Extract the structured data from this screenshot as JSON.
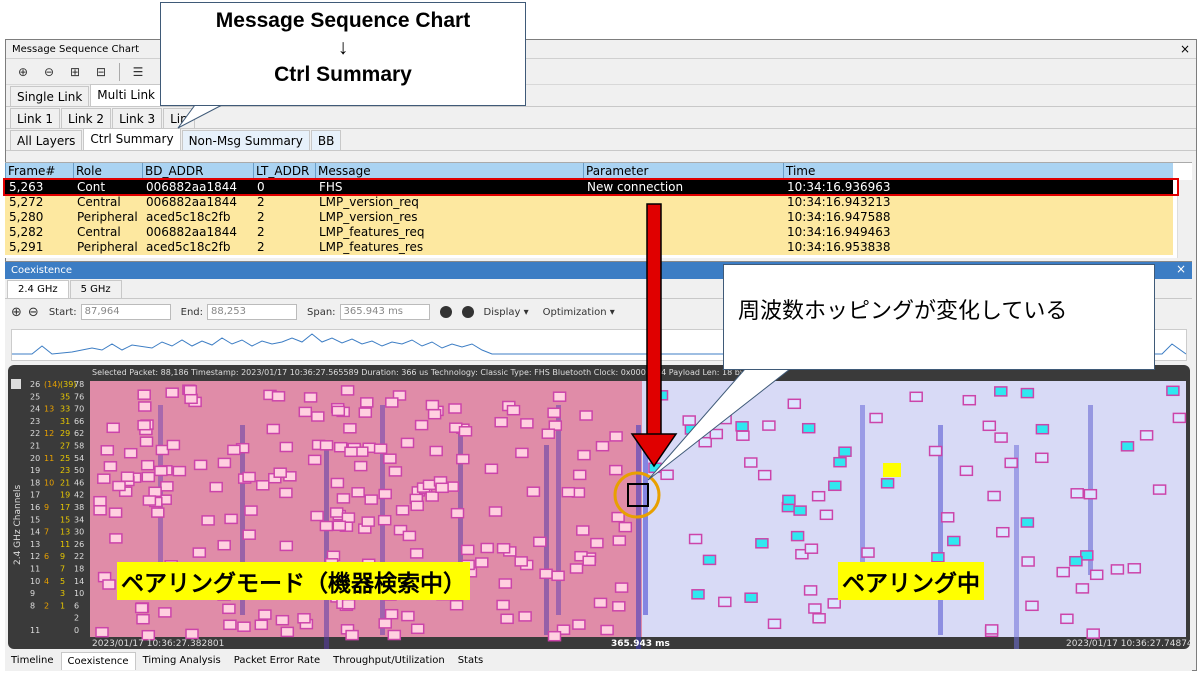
{
  "msc": {
    "title": "Message Sequence Chart",
    "close": "×",
    "link_tabs": [
      "Single Link",
      "Multi Link"
    ],
    "sub_tabs": [
      "Link 1",
      "Link 2",
      "Link 3",
      "Lin"
    ],
    "layer_tabs": [
      "All Layers",
      "Ctrl Summary",
      "Non-Msg Summary",
      "BB"
    ],
    "columns": [
      "Frame#",
      "Role",
      "BD_ADDR",
      "LT_ADDR",
      "Message",
      "Parameter",
      "Time"
    ],
    "rows": [
      [
        "5,263",
        "Cont",
        "006882aa1844",
        "0",
        "FHS",
        "New connection",
        "10:34:16.936963"
      ],
      [
        "5,272",
        "Central",
        "006882aa1844",
        "2",
        "LMP_version_req",
        "",
        "10:34:16.943213"
      ],
      [
        "5,280",
        "Peripheral",
        "aced5c18c2fb",
        "2",
        "LMP_version_res",
        "",
        "10:34:16.947588"
      ],
      [
        "5,282",
        "Central",
        "006882aa1844",
        "2",
        "LMP_features_req",
        "",
        "10:34:16.949463"
      ],
      [
        "5,291",
        "Peripheral",
        "aced5c18c2fb",
        "2",
        "LMP_features_res",
        "",
        "10:34:16.953838"
      ]
    ]
  },
  "coex": {
    "title": "Coexistence",
    "close": "×",
    "freq_tabs": [
      "2.4 GHz",
      "5 GHz"
    ],
    "start_label": "Start:",
    "start_value": "87,964",
    "end_label": "End:",
    "end_value": "88,253",
    "span_label": "Span:",
    "span_value": "365.943 ms",
    "display_menu": "Display",
    "optimization_menu": "Optimization",
    "info": "Selected Packet: 88,186    Timestamp: 2023/01/17 10:36:27.565589    Duration: 366 us    Technology: Classic    Type: FHS    Bluetooth Clock: 0x0007134    Payload Len: 18 bytes",
    "y_axis_label": "2.4 GHz Channels",
    "ticks": [
      [
        "26",
        "(14)",
        "(39)",
        "78"
      ],
      [
        "25",
        "",
        "35",
        "76"
      ],
      [
        "24",
        "13",
        "33",
        "70"
      ],
      [
        "23",
        "",
        "31",
        "66"
      ],
      [
        "22",
        "12",
        "29",
        "62"
      ],
      [
        "21",
        "",
        "27",
        "58"
      ],
      [
        "20",
        "11",
        "25",
        "54"
      ],
      [
        "19",
        "",
        "23",
        "50"
      ],
      [
        "18",
        "10",
        "21",
        "46"
      ],
      [
        "17",
        "",
        "19",
        "42"
      ],
      [
        "16",
        "9",
        "17",
        "38"
      ],
      [
        "15",
        "",
        "15",
        "34"
      ],
      [
        "14",
        "7",
        "13",
        "30"
      ],
      [
        "13",
        "",
        "11",
        "26"
      ],
      [
        "12",
        "6",
        "9",
        "22"
      ],
      [
        "11",
        "",
        "7",
        "18"
      ],
      [
        "10",
        "4",
        "5",
        "14"
      ],
      [
        "9",
        "",
        "3",
        "10"
      ],
      [
        "8",
        "2",
        "1",
        "6"
      ],
      [
        "",
        "",
        "",
        "2"
      ],
      [
        "11",
        "",
        "",
        "0"
      ]
    ],
    "start_time": "2023/01/17 10:36:27.382801",
    "span_center": "365.943 ms",
    "end_time": "2023/01/17 10:36:27.748744"
  },
  "bottom_tabs": [
    "Timeline",
    "Coexistence",
    "Timing Analysis",
    "Packet Error Rate",
    "Throughput/Utilization",
    "Stats"
  ],
  "annotations": {
    "callout_top_line1": "Message  Sequence Chart",
    "callout_top_arrow": "↓",
    "callout_top_line2": "Ctrl Summary",
    "callout_right": "周波数ホッピングが変化している",
    "label_left": "ペアリングモード（機器検索中）",
    "label_right": "ペアリング中"
  },
  "colors": {
    "accent": "#3c7dc4",
    "highlight": "#ffff00",
    "selection_box": "#e00000",
    "pink_region": "#e08ca8",
    "blue_region": "#d8daf6"
  }
}
